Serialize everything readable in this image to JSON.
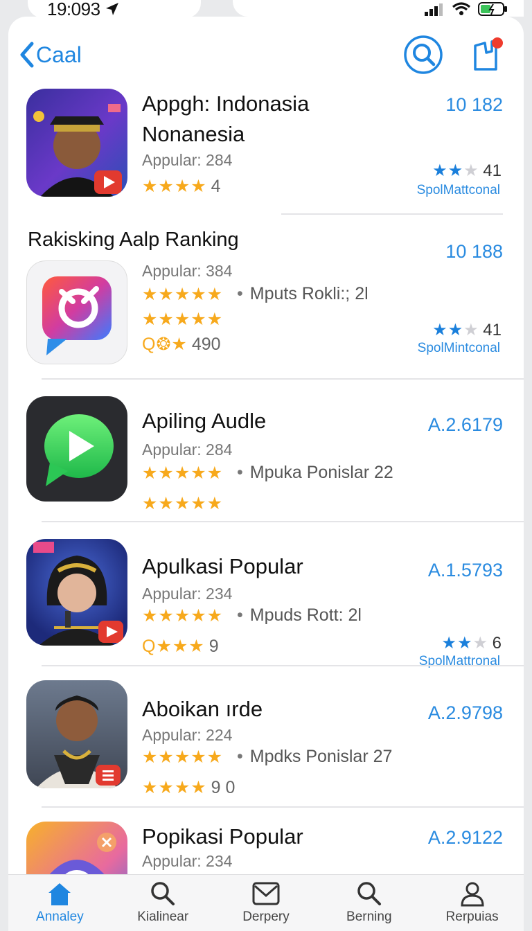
{
  "status": {
    "time": "19:093"
  },
  "nav": {
    "back_label": "Caal"
  },
  "apps": [
    {
      "title_line1": "Appgh: Indonasia",
      "title_line2": "Nonanesia",
      "sub": "Appular: 284",
      "stars_text": "★★★★",
      "count": "4",
      "price": "10 182",
      "right_rating": "41",
      "right_sub": "SpolMattconal"
    },
    {
      "sub": "Appular: 384",
      "stars_text": "★★★★★",
      "meta": "Mputs Rokli:; 2l",
      "stars2_text": "★★★★★",
      "extra": "490",
      "right_rating": "41",
      "right_sub": "SpolMintconal"
    },
    {
      "title": "Apiling Audle",
      "sub": "Appular: 284",
      "stars_text": "★★★★★",
      "meta": "Mpuka Ponislar 22",
      "stars2_text": "★★★★★",
      "price": "A.2.6179"
    },
    {
      "title": "Apulkasi Popular",
      "sub": "Appular: 234",
      "stars_text": "★★★★★",
      "meta": "Mpuds Rott: 2l",
      "stars2_text": "Q★★★",
      "count": "9",
      "price": "A.1.5793",
      "right_rating": "6",
      "right_sub": "SpolMattronal"
    },
    {
      "title": "Aboikan ırde",
      "sub": "Appular: 224",
      "stars_text": "★★★★★",
      "meta": "Mpdks Ponislar 27",
      "stars2_text": "★★★★",
      "count": "9 0",
      "price": "A.2.9798"
    },
    {
      "title": "Popikasi Popular",
      "sub": "Appular: 234",
      "price": "A.2.9122"
    }
  ],
  "section": {
    "title": "Rakisking Aalp Ranking",
    "price": "10 188"
  },
  "tabs": [
    {
      "label": "Annaley",
      "icon": "home-icon"
    },
    {
      "label": "Kialinear",
      "icon": "search-icon"
    },
    {
      "label": "Derpery",
      "icon": "mail-icon"
    },
    {
      "label": "Berning",
      "icon": "search-icon"
    },
    {
      "label": "Rerpuias",
      "icon": "person-icon"
    }
  ],
  "colors": {
    "accent": "#1f86e0",
    "star": "#f7a91c",
    "blue_star": "#1a7fdb"
  }
}
